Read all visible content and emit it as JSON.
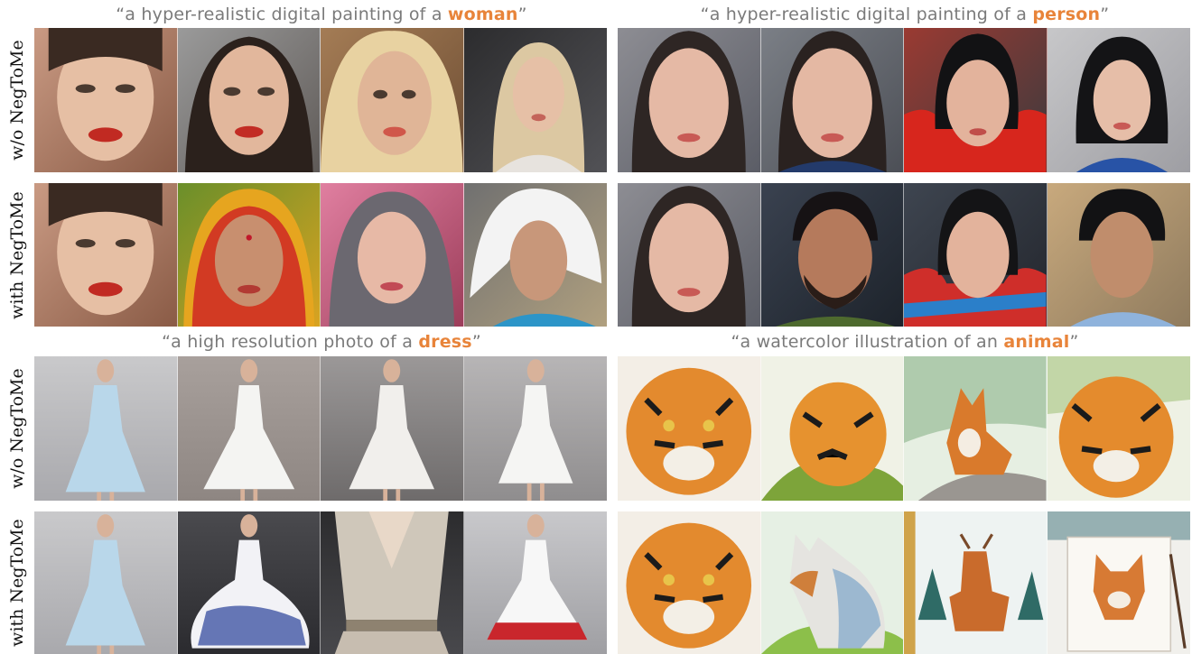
{
  "titles": [
    {
      "prefix": "“a hyper-realistic digital painting of a ",
      "highlight": "woman",
      "suffix": "”"
    },
    {
      "prefix": "“a hyper-realistic digital painting of a ",
      "highlight": "person",
      "suffix": "”"
    },
    {
      "prefix": "“a high resolution photo of a ",
      "highlight": "dress",
      "suffix": "”"
    },
    {
      "prefix": "“a watercolor illustration of an ",
      "highlight": "animal",
      "suffix": "”"
    }
  ],
  "row_labels": [
    "w/o NegToMe",
    "with NegToMe",
    "w/o NegToMe",
    "with NegToMe"
  ],
  "colors": {
    "highlight": "#e8843a",
    "title_text": "#7a7a7a"
  },
  "panels": {
    "woman_without": [
      "portrait-tile",
      "portrait-tile",
      "portrait-tile",
      "portrait-tile"
    ],
    "woman_with": [
      "portrait-tile",
      "portrait-tile",
      "portrait-tile",
      "portrait-tile"
    ],
    "person_without": [
      "portrait-tile",
      "portrait-tile",
      "portrait-tile",
      "portrait-tile"
    ],
    "person_with": [
      "portrait-tile",
      "portrait-tile",
      "portrait-tile",
      "portrait-tile"
    ],
    "dress_without": [
      "dress-tile",
      "dress-tile",
      "dress-tile",
      "dress-tile"
    ],
    "dress_with": [
      "dress-tile",
      "dress-tile",
      "dress-tile",
      "dress-tile"
    ],
    "animal_without": [
      "animal-tile",
      "animal-tile",
      "animal-tile",
      "animal-tile"
    ],
    "animal_with": [
      "animal-tile",
      "animal-tile",
      "animal-tile",
      "animal-tile"
    ]
  }
}
